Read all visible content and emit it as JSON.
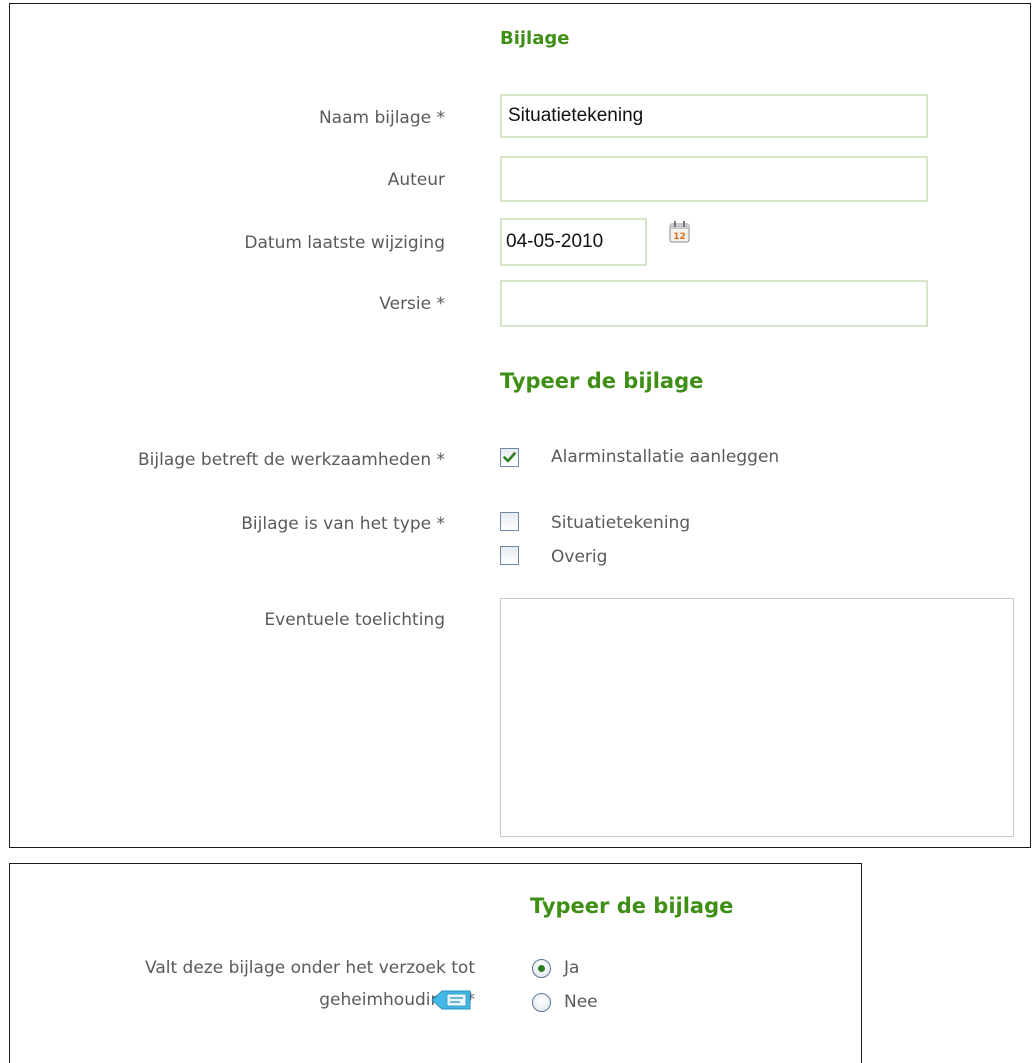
{
  "bijlage_section": {
    "heading": "Bijlage",
    "naam": {
      "label": "Naam bijlage *",
      "value": "Situatietekening"
    },
    "auteur": {
      "label": "Auteur",
      "value": ""
    },
    "datum": {
      "label": "Datum laatste wijziging",
      "value": "04-05-2010",
      "calendar_icon": "calendar-icon",
      "calendar_icon_text": "12"
    },
    "versie": {
      "label": "Versie *",
      "value": ""
    }
  },
  "typeer_section": {
    "heading": "Typeer de bijlage",
    "werkzaamheden": {
      "label": "Bijlage betreft de werkzaamheden *",
      "options": [
        {
          "label": "Alarminstallatie aanleggen",
          "checked": true
        }
      ]
    },
    "type": {
      "label": "Bijlage is van het type *",
      "options": [
        {
          "label": "Situatietekening",
          "checked": false
        },
        {
          "label": "Overig",
          "checked": false
        }
      ]
    },
    "toelichting": {
      "label": "Eventuele toelichting",
      "value": ""
    }
  },
  "geheimhouding_section": {
    "heading": "Typeer de bijlage",
    "question": {
      "line1": "Valt deze bijlage onder het verzoek tot",
      "line2": "geheimhouding? *"
    },
    "help_icon": "comment-help-icon",
    "options": [
      {
        "label": "Ja",
        "selected": true
      },
      {
        "label": "Nee",
        "selected": false
      }
    ]
  },
  "colors": {
    "heading_green": "#3f8f16",
    "field_border": "#d6e4c7",
    "check_green": "#2f7d24",
    "panel_border": "#1a1a1a"
  }
}
